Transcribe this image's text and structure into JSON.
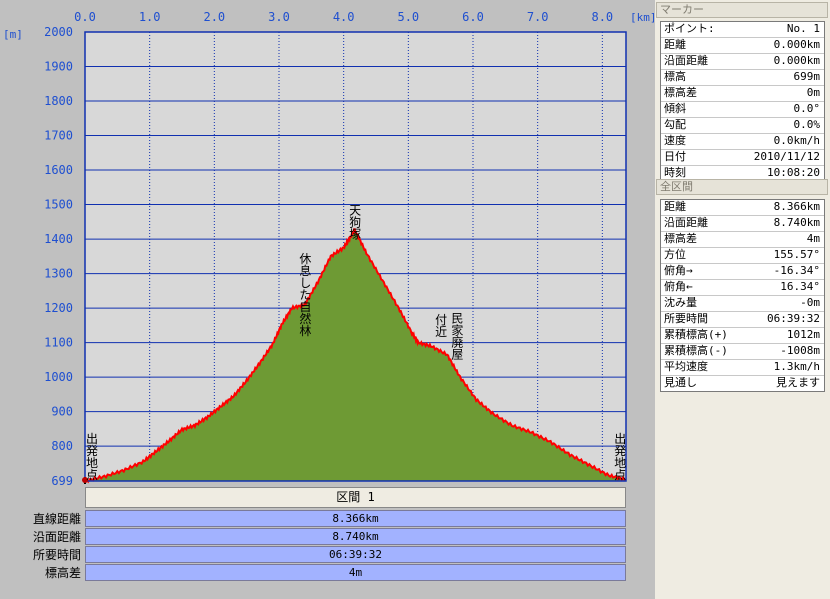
{
  "chart_data": {
    "type": "area",
    "x_unit": "[km]",
    "y_unit": "[m]",
    "xlim": [
      0,
      8.366
    ],
    "ylim": [
      699,
      2000
    ],
    "x_ticks": [
      "0.0",
      "1.0",
      "2.0",
      "3.0",
      "4.0",
      "5.0",
      "6.0",
      "7.0",
      "8.0"
    ],
    "y_ticks": [
      "2000",
      "1900",
      "1800",
      "1700",
      "1600",
      "1500",
      "1400",
      "1300",
      "1200",
      "1100",
      "1000",
      "900",
      "800",
      "699"
    ],
    "grid": true,
    "profile": [
      [
        0,
        699
      ],
      [
        0.3,
        712
      ],
      [
        0.6,
        730
      ],
      [
        0.9,
        755
      ],
      [
        1.1,
        785
      ],
      [
        1.3,
        815
      ],
      [
        1.5,
        848
      ],
      [
        1.7,
        860
      ],
      [
        1.9,
        885
      ],
      [
        2.1,
        915
      ],
      [
        2.3,
        945
      ],
      [
        2.5,
        990
      ],
      [
        2.7,
        1040
      ],
      [
        2.9,
        1095
      ],
      [
        3.05,
        1155
      ],
      [
        3.2,
        1200
      ],
      [
        3.4,
        1210
      ],
      [
        3.6,
        1275
      ],
      [
        3.8,
        1350
      ],
      [
        4.0,
        1375
      ],
      [
        4.12,
        1410
      ],
      [
        4.17,
        1427
      ],
      [
        4.35,
        1360
      ],
      [
        4.6,
        1280
      ],
      [
        4.85,
        1200
      ],
      [
        5.05,
        1130
      ],
      [
        5.15,
        1100
      ],
      [
        5.35,
        1090
      ],
      [
        5.6,
        1065
      ],
      [
        5.8,
        1000
      ],
      [
        6.05,
        935
      ],
      [
        6.3,
        895
      ],
      [
        6.6,
        860
      ],
      [
        6.9,
        840
      ],
      [
        7.2,
        812
      ],
      [
        7.5,
        775
      ],
      [
        7.8,
        745
      ],
      [
        8.1,
        715
      ],
      [
        8.366,
        703
      ]
    ],
    "annotations": [
      {
        "text": "出発地点",
        "x": 0.1,
        "y": 770
      },
      {
        "text": "休息した自然林",
        "x": 3.4,
        "y": 1240
      },
      {
        "text": "天狗塚",
        "x": 4.17,
        "y": 1450
      },
      {
        "text": "付近",
        "x": 5.5,
        "y": 1150
      },
      {
        "text": "民家廃屋",
        "x": 5.75,
        "y": 1120
      },
      {
        "text": "出発地点",
        "x": 8.27,
        "y": 770
      }
    ],
    "line_color": "#ff0000",
    "fill_color": "#6e9a34",
    "plot_background": "#d8d8d8",
    "grid_color": "#1030b0",
    "label_color": "#1e4fd0"
  },
  "section": {
    "header": "区間 1",
    "rows": [
      {
        "label": "直線距離",
        "value": "8.366km"
      },
      {
        "label": "沿面距離",
        "value": "8.740km"
      },
      {
        "label": "所要時間",
        "value": "06:39:32"
      },
      {
        "label": "標高差",
        "value": "4m"
      }
    ]
  },
  "marker_panel": {
    "title": "マーカー",
    "rows": [
      {
        "k": "ポイント:",
        "v": "No. 1"
      },
      {
        "k": "距離",
        "v": "0.000km"
      },
      {
        "k": "沿面距離",
        "v": "0.000km"
      },
      {
        "k": "標高",
        "v": "699m"
      },
      {
        "k": "標高差",
        "v": "0m"
      },
      {
        "k": "傾斜",
        "v": "0.0°"
      },
      {
        "k": "勾配",
        "v": "0.0%"
      },
      {
        "k": "速度",
        "v": "0.0km/h"
      },
      {
        "k": "日付",
        "v": "2010/11/12"
      },
      {
        "k": "時刻",
        "v": "10:08:20"
      }
    ]
  },
  "total_panel": {
    "title": "全区間",
    "rows": [
      {
        "k": "距離",
        "v": "8.366km"
      },
      {
        "k": "沿面距離",
        "v": "8.740km"
      },
      {
        "k": "標高差",
        "v": "4m"
      },
      {
        "k": "方位",
        "v": "155.57°"
      },
      {
        "k": "俯角→",
        "v": "-16.34°"
      },
      {
        "k": "俯角←",
        "v": "16.34°"
      },
      {
        "k": "沈み量",
        "v": "-0m"
      },
      {
        "k": "所要時間",
        "v": "06:39:32"
      },
      {
        "k": "累積標高(+)",
        "v": "1012m"
      },
      {
        "k": "累積標高(-)",
        "v": "-1008m"
      },
      {
        "k": "平均速度",
        "v": "1.3km/h"
      },
      {
        "k": "見通し",
        "v": "見えます"
      }
    ]
  }
}
